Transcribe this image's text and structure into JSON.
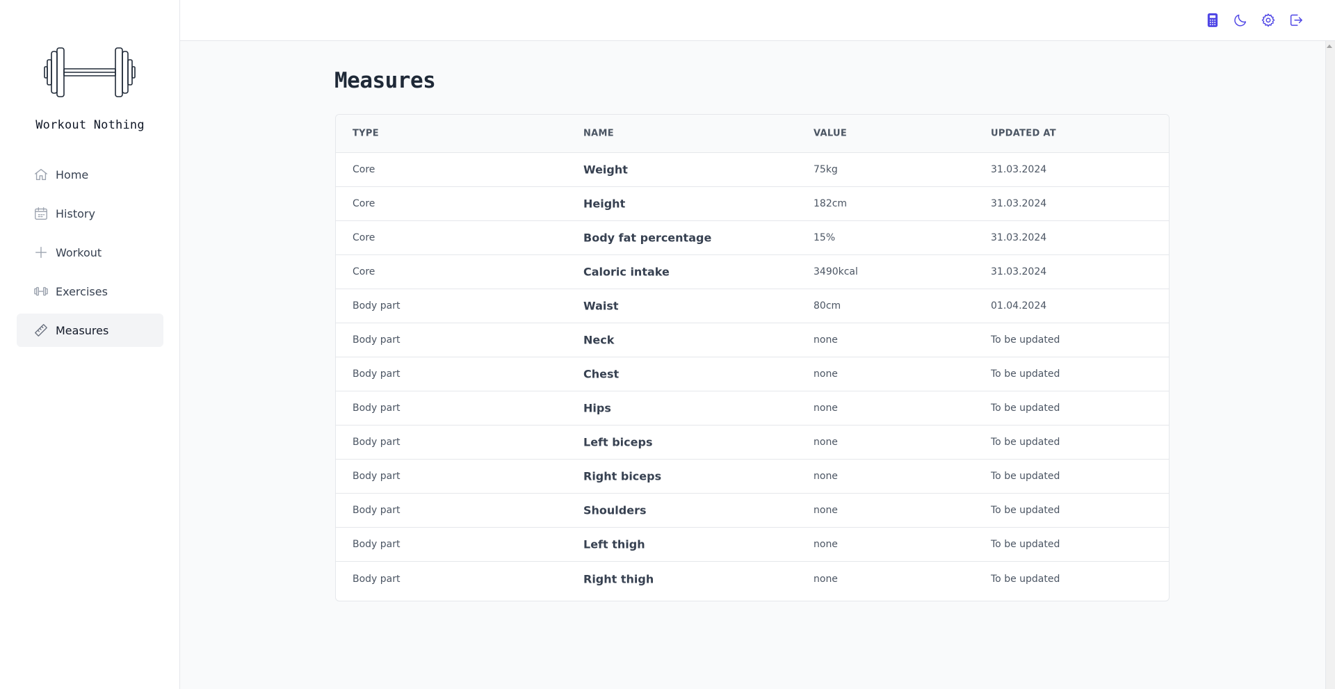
{
  "app": {
    "brand": "Workout Nothing"
  },
  "sidebar": {
    "items": [
      {
        "label": "Home",
        "icon": "home-icon"
      },
      {
        "label": "History",
        "icon": "calendar-icon"
      },
      {
        "label": "Workout",
        "icon": "plus-icon"
      },
      {
        "label": "Exercises",
        "icon": "dumbbell-icon"
      },
      {
        "label": "Measures",
        "icon": "ruler-icon",
        "active": true
      }
    ]
  },
  "topbar": {
    "icons": [
      "calculator-icon",
      "moon-icon",
      "gear-icon",
      "logout-icon"
    ],
    "accent": "#4f46e5"
  },
  "page": {
    "title": "Measures"
  },
  "table": {
    "headers": [
      "TYPE",
      "NAME",
      "VALUE",
      "UPDATED AT"
    ],
    "rows": [
      {
        "type": "Core",
        "name": "Weight",
        "value": "75kg",
        "updated": "31.03.2024"
      },
      {
        "type": "Core",
        "name": "Height",
        "value": "182cm",
        "updated": "31.03.2024"
      },
      {
        "type": "Core",
        "name": "Body fat percentage",
        "value": "15%",
        "updated": "31.03.2024"
      },
      {
        "type": "Core",
        "name": "Caloric intake",
        "value": "3490kcal",
        "updated": "31.03.2024"
      },
      {
        "type": "Body part",
        "name": "Waist",
        "value": "80cm",
        "updated": "01.04.2024"
      },
      {
        "type": "Body part",
        "name": "Neck",
        "value": "none",
        "updated": "To be updated"
      },
      {
        "type": "Body part",
        "name": "Chest",
        "value": "none",
        "updated": "To be updated"
      },
      {
        "type": "Body part",
        "name": "Hips",
        "value": "none",
        "updated": "To be updated"
      },
      {
        "type": "Body part",
        "name": "Left biceps",
        "value": "none",
        "updated": "To be updated"
      },
      {
        "type": "Body part",
        "name": "Right biceps",
        "value": "none",
        "updated": "To be updated"
      },
      {
        "type": "Body part",
        "name": "Shoulders",
        "value": "none",
        "updated": "To be updated"
      },
      {
        "type": "Body part",
        "name": "Left thigh",
        "value": "none",
        "updated": "To be updated"
      },
      {
        "type": "Body part",
        "name": "Right thigh",
        "value": "none",
        "updated": "To be updated"
      }
    ]
  }
}
